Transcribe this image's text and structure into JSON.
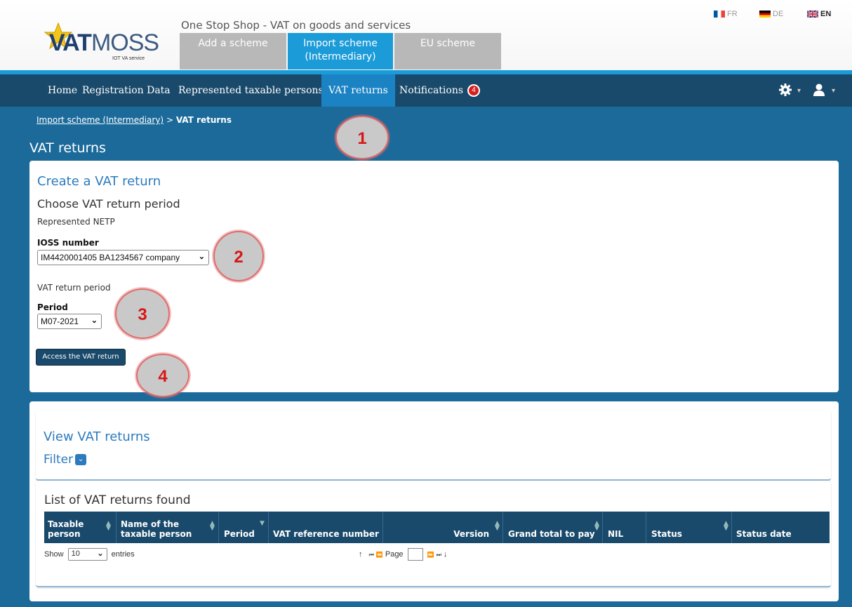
{
  "header": {
    "logo_text_bold": "VAT",
    "logo_text_light": "MOSS",
    "logo_sub": "IOT VA service",
    "site_title": "One Stop Shop - VAT on goods and services",
    "scheme_tabs": [
      {
        "label": "Add a scheme"
      },
      {
        "label": "Import scheme (Intermediary)"
      },
      {
        "label": "EU scheme"
      }
    ],
    "languages": [
      {
        "code": "FR"
      },
      {
        "code": "DE"
      },
      {
        "code": "EN"
      }
    ]
  },
  "nav": {
    "items": [
      {
        "label": "Home"
      },
      {
        "label": "Registration Data"
      },
      {
        "label": "Represented taxable persons"
      },
      {
        "label": "VAT returns"
      },
      {
        "label": "Notifications"
      }
    ],
    "notification_count": "4",
    "active": "VAT returns"
  },
  "breadcrumb": {
    "link": "Import scheme (Intermediary)",
    "separator": ">",
    "current": "VAT returns"
  },
  "page_title": "VAT returns",
  "create": {
    "title": "Create a VAT return",
    "subtitle": "Choose VAT return period",
    "represented_label": "Represented NETP",
    "ioss_label": "IOSS number",
    "ioss_value": "IM4420001405 BA1234567 company",
    "period_heading": "VAT return period",
    "period_label": "Period",
    "period_value": "M07-2021",
    "access_button": "Access the VAT return"
  },
  "callouts": [
    "1",
    "2",
    "3",
    "4"
  ],
  "view": {
    "title": "View VAT returns",
    "filter_label": "Filter"
  },
  "list": {
    "title": "List of VAT returns found",
    "columns": [
      {
        "label": "Taxable person"
      },
      {
        "label": "Name of the taxable person"
      },
      {
        "label": "Period"
      },
      {
        "label": "VAT reference number"
      },
      {
        "label": "Version"
      },
      {
        "label": "Grand total to pay"
      },
      {
        "label": "NIL"
      },
      {
        "label": "Status"
      },
      {
        "label": "Status date"
      }
    ],
    "show_label": "Show",
    "show_value": "10",
    "entries_label": "entries",
    "page_label": "Page"
  },
  "colors": {
    "nav_bg": "#1a4a6b",
    "accent": "#1b9bd8",
    "main_bg": "#1b6a9a",
    "link": "#2c7bbd",
    "badge": "#d81e1e"
  }
}
